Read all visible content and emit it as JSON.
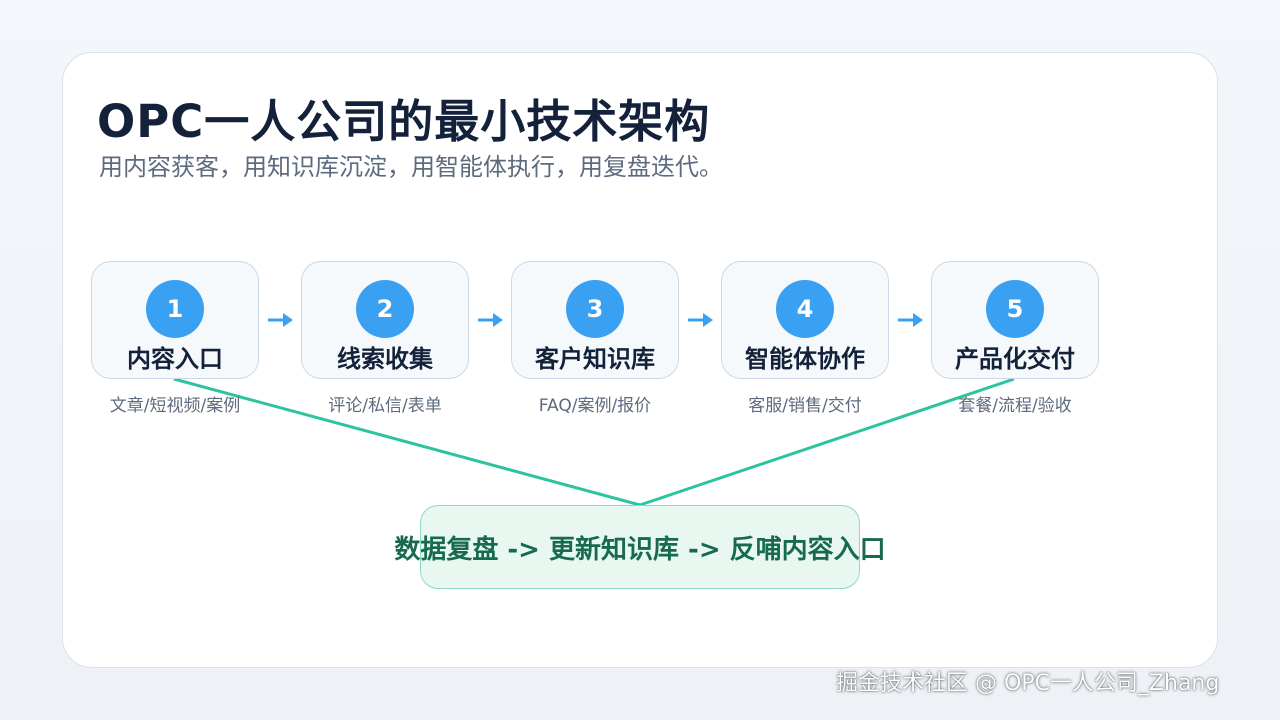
{
  "title": "OPC一人公司的最小技术架构",
  "subtitle": "用内容获客，用知识库沉淀，用智能体执行，用复盘迭代。",
  "steps": [
    {
      "number": "1",
      "title": "内容入口",
      "sub": "文章/短视频/案例"
    },
    {
      "number": "2",
      "title": "线索收集",
      "sub": "评论/私信/表单"
    },
    {
      "number": "3",
      "title": "客户知识库",
      "sub": "FAQ/案例/报价"
    },
    {
      "number": "4",
      "title": "智能体协作",
      "sub": "客服/销售/交付"
    },
    {
      "number": "5",
      "title": "产品化交付",
      "sub": "套餐/流程/验收"
    }
  ],
  "loop_text": "数据复盘 -> 更新知识库 -> 反哺内容入口",
  "watermark": "掘金技术社区 @ OPC一人公司_Zhang",
  "colors": {
    "accent_blue": "#3aa0f2",
    "teal_line": "#2cc3a0",
    "loop_bg": "#e8f8f1",
    "loop_text": "#176a50",
    "title": "#14213a",
    "muted": "#5d6b7e"
  },
  "icons": [
    "arrow-right-icon"
  ]
}
